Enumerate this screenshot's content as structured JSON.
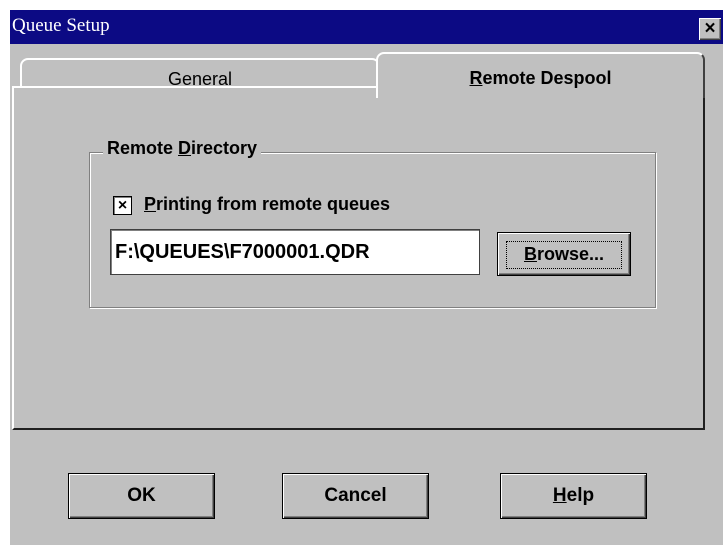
{
  "window": {
    "title": "Queue Setup",
    "close_glyph": "×",
    "close_icon": "close-icon"
  },
  "tabs": [
    {
      "label_mnemonic": "G",
      "label_rest": "eneral",
      "active": false
    },
    {
      "label_mnemonic": "R",
      "label_rest": "emote Despool",
      "active": true
    }
  ],
  "group": {
    "label_pre": "Remote ",
    "label_mnemonic": "D",
    "label_rest": "irectory"
  },
  "checkbox": {
    "checked": true,
    "mark": "×",
    "label_mnemonic": "P",
    "label_rest": "rinting from remote queues"
  },
  "path_field": {
    "value": "F:\\QUEUES\\F7000001.QDR"
  },
  "browse_button": {
    "label_mnemonic": "B",
    "label_rest": "rowse..."
  },
  "buttons": {
    "ok": "OK",
    "cancel": "Cancel",
    "help_mnemonic": "H",
    "help_rest": "elp"
  },
  "colors": {
    "titlebar": "#0c0a84",
    "face": "#c0c0c0"
  }
}
